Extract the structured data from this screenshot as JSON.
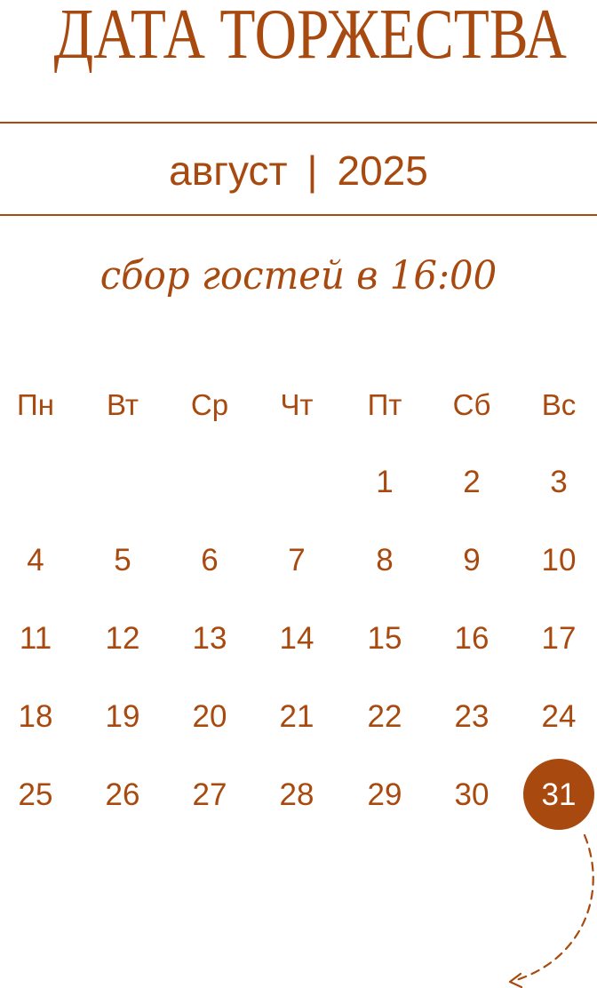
{
  "title": "ДАТА ТОРЖЕСТВА",
  "month": "август",
  "separator": "|",
  "year": "2025",
  "subtitle": "сбор гостей в 16:00",
  "weekdays": [
    "Пн",
    "Вт",
    "Ср",
    "Чт",
    "Пт",
    "Сб",
    "Вс"
  ],
  "weeks": [
    [
      "",
      "",
      "",
      "",
      "1",
      "2",
      "3"
    ],
    [
      "4",
      "5",
      "6",
      "7",
      "8",
      "9",
      "10"
    ],
    [
      "11",
      "12",
      "13",
      "14",
      "15",
      "16",
      "17"
    ],
    [
      "18",
      "19",
      "20",
      "21",
      "22",
      "23",
      "24"
    ],
    [
      "25",
      "26",
      "27",
      "28",
      "29",
      "30",
      "31"
    ]
  ],
  "selected_day": "31",
  "colors": {
    "accent": "#a84a0f",
    "background": "#ffffff",
    "selected_text": "#ffffff"
  },
  "icons": {
    "arrow": "dashed-curved-arrow-icon"
  }
}
